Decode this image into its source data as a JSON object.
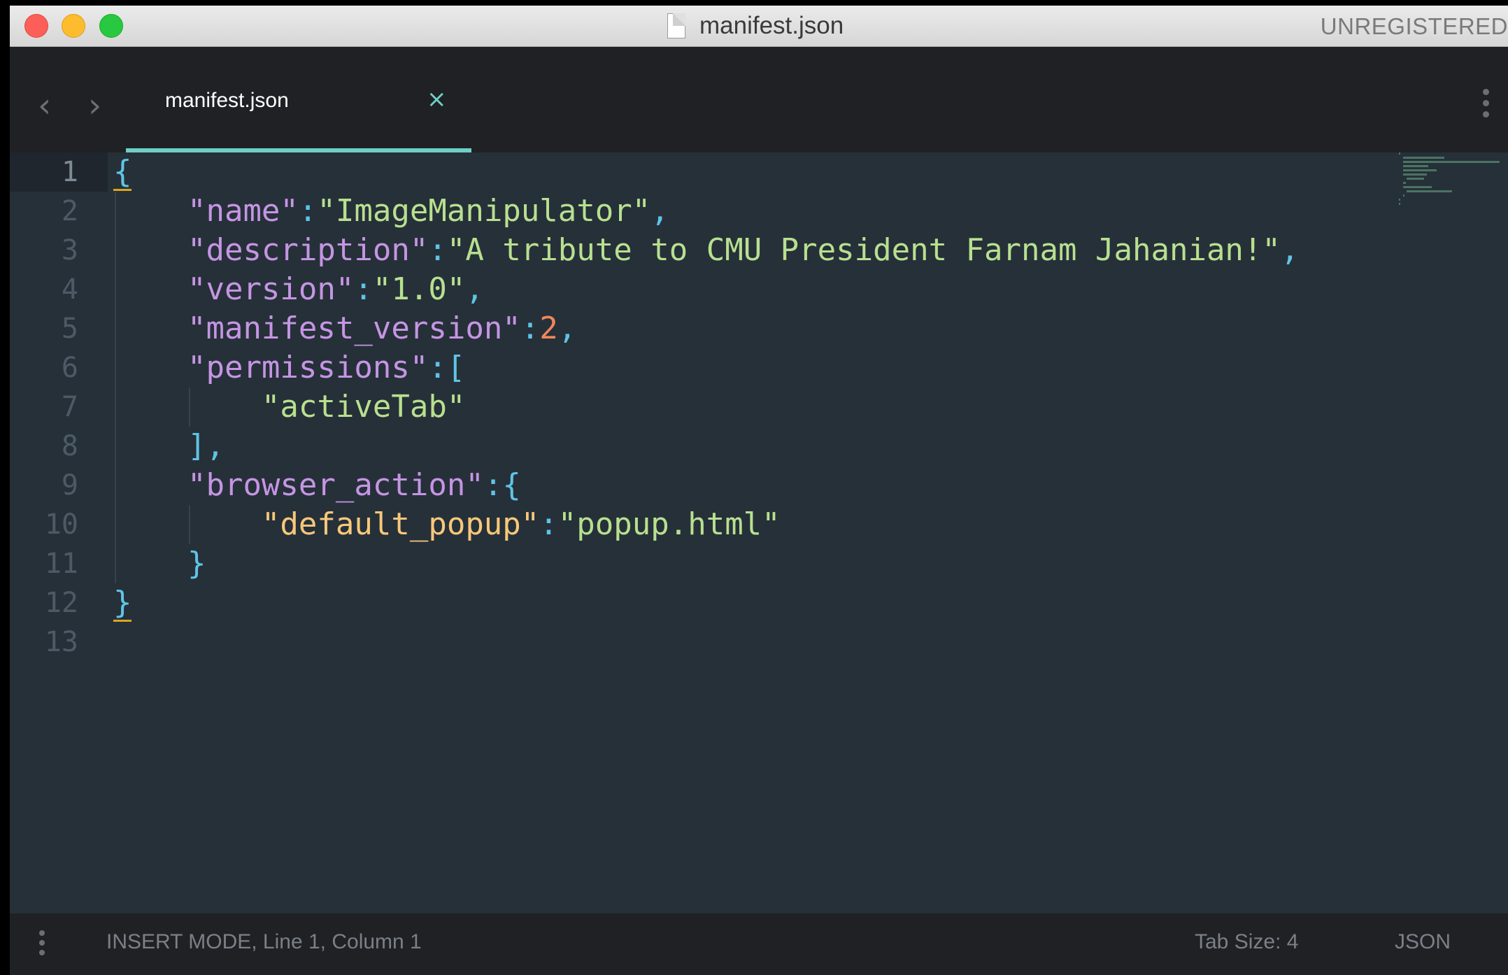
{
  "window": {
    "title": "manifest.json",
    "registration_status": "UNREGISTERED"
  },
  "tabs": [
    {
      "label": "manifest.json",
      "close_icon": "×",
      "active": true
    }
  ],
  "nav": {
    "back_icon": "‹",
    "forward_icon": "›"
  },
  "editor": {
    "line_numbers": [
      "1",
      "2",
      "3",
      "4",
      "5",
      "6",
      "7",
      "8",
      "9",
      "10",
      "11",
      "12",
      "13"
    ],
    "active_line": 1,
    "lines": [
      "{",
      "    \"name\":\"ImageManipulator\",",
      "    \"description\":\"A tribute to CMU President Farnam Jahanian!\",",
      "    \"version\":\"1.0\",",
      "    \"manifest_version\":2,",
      "    \"permissions\":[",
      "        \"activeTab\"",
      "    ],",
      "    \"browser_action\":{",
      "        \"default_popup\":\"popup.html\"",
      "    }",
      "}",
      ""
    ]
  },
  "status_bar": {
    "mode_position": "INSERT MODE, Line 1, Column 1",
    "tab_size": "Tab Size: 4",
    "syntax": "JSON"
  },
  "colors": {
    "accent": "#6fcfc8",
    "editor_bg": "#263039",
    "chrome_bg": "#1f2124",
    "string": "#b8e08f",
    "key": "#c595e3",
    "number": "#f0875b",
    "punctuation": "#5fc4e6"
  }
}
